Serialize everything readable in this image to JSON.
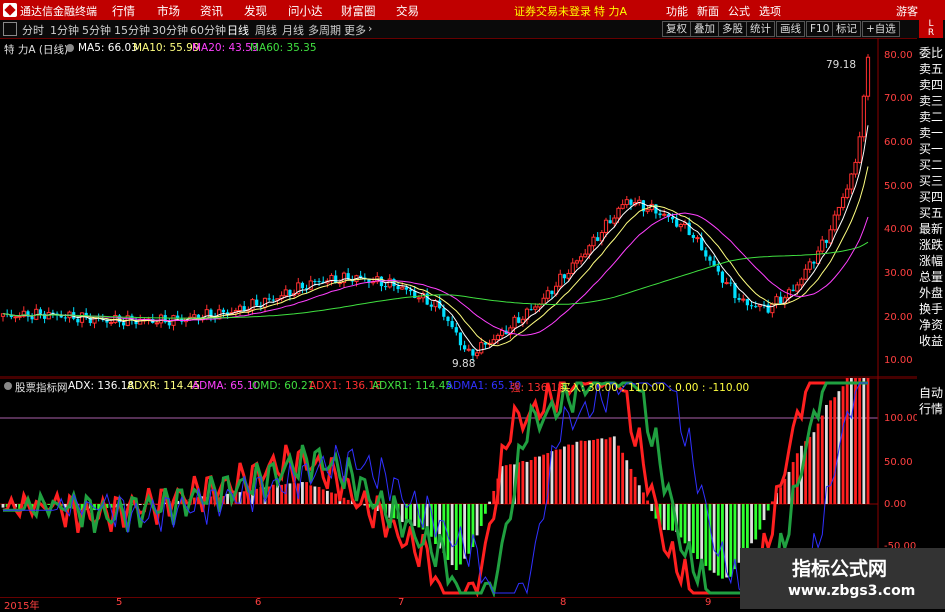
{
  "app_title": "通达信金融终端",
  "menu": [
    "行情",
    "市场",
    "资讯",
    "发现",
    "问小达",
    "财富圈",
    "交易"
  ],
  "notice": "证券交易未登录",
  "stock_name": "特 力A",
  "right_menu": [
    "功能",
    "新面",
    "公式",
    "选项"
  ],
  "guest": "游客",
  "periods": [
    "分时",
    "1分钟",
    "5分钟",
    "15分钟",
    "30分钟",
    "60分钟",
    "日线",
    "周线",
    "月线",
    "多周期",
    "更多"
  ],
  "active_period": "日线",
  "right_buttons": [
    "复权",
    "叠加",
    "多股",
    "统计",
    "画线",
    "F10",
    "标记",
    "+自选"
  ],
  "main_legend": {
    "name": "特 力A (日线)",
    "ma5": "MA5: 66.03",
    "ma10": "MA10: 55.99",
    "ma20": "MA20: 43.53",
    "ma60": "MA60: 35.35"
  },
  "price_labels": {
    "high": "79.18",
    "low": "9.88"
  },
  "y_ticks_main": [
    "80.00",
    "70.00",
    "60.00",
    "50.00",
    "40.00",
    "30.00",
    "20.00",
    "10.00"
  ],
  "ind_legend": {
    "name": "股票指标网",
    "adx": "ADX: 136.18",
    "adxr": "ADXR: 114.45",
    "adma": "ADMA: 65.10",
    "omd": "OMD: 60.21",
    "adx1": "ADX1: 136.18",
    "adxr1": "ADXR1: 114.45",
    "adma1": "ADMA1: 65.10",
    "strong": "强: 136.18",
    "buy": "买入: 30.00 : 110.00 : 0.00 : -110.00"
  },
  "y_ticks_ind": [
    "100.00",
    "50.00",
    "0.00",
    "-50.00"
  ],
  "x_labels": [
    "2015年",
    "5",
    "6",
    "7",
    "8",
    "9"
  ],
  "side_tabs": [
    "委比",
    "卖五",
    "卖四",
    "卖三",
    "卖二",
    "卖一",
    "买一",
    "买二",
    "买三",
    "买四",
    "买五",
    "最新",
    "涨跌",
    "涨幅",
    "总量",
    "外盘",
    "换手",
    "净资",
    "收益"
  ],
  "side_tabs2": [
    "自动",
    "行情"
  ],
  "watermark": {
    "title": "指标公式网",
    "url": "www.zbgs3.com"
  },
  "colors": {
    "up": "#ff3030",
    "down": "#00e0ff",
    "ma5": "#ffffff",
    "ma10": "#ffff80",
    "ma20": "#ff40ff",
    "ma60": "#40e040"
  }
}
